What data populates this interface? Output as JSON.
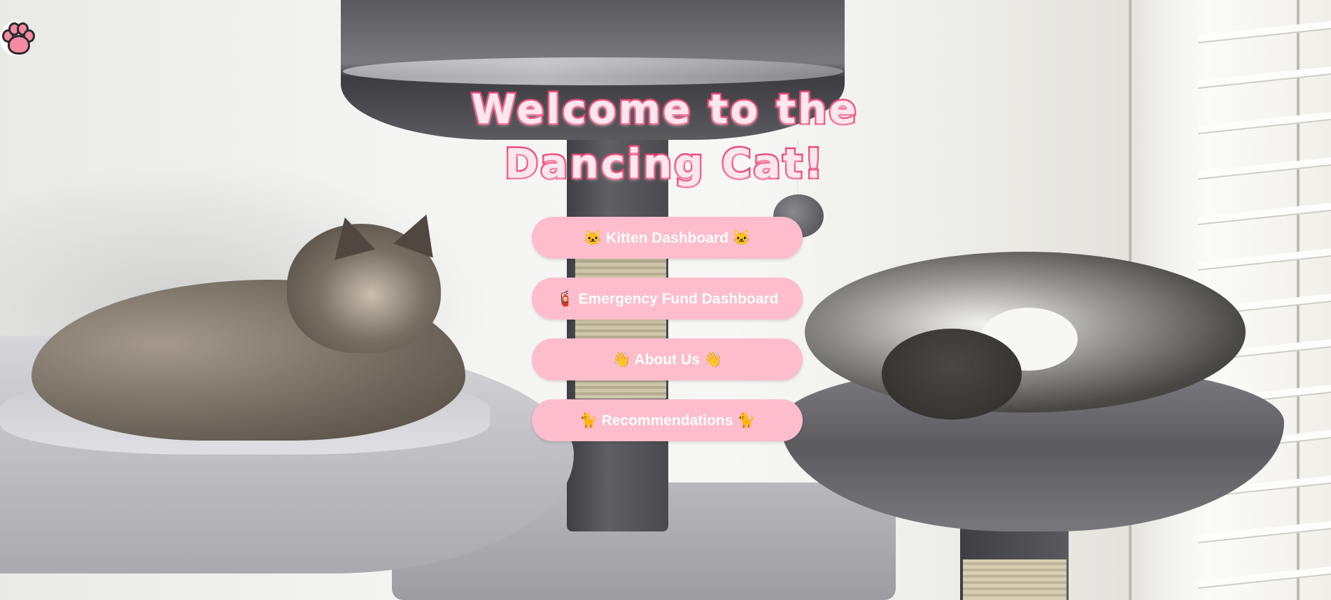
{
  "page": {
    "logo_icon": "paw-print-icon",
    "title": "Welcome to the Dancing Cat!"
  },
  "menu": {
    "items": [
      {
        "label": "🐱 Kitten Dashboard 🐱",
        "icon": "cat-face-icon"
      },
      {
        "label": "🧯 Emergency Fund Dashboard",
        "icon": "fire-extinguisher-icon"
      },
      {
        "label": "👋 About Us 👋",
        "icon": "waving-hand-icon"
      },
      {
        "label": "🐈 Recommendations 🐈",
        "icon": "cat-icon"
      }
    ]
  },
  "colors": {
    "button_bg": "#fdbdcc",
    "button_text": "#ffffff",
    "title_stroke": "#ee3f72",
    "title_fill": "#fde7ee",
    "paw_pad": "#f48aa4"
  }
}
